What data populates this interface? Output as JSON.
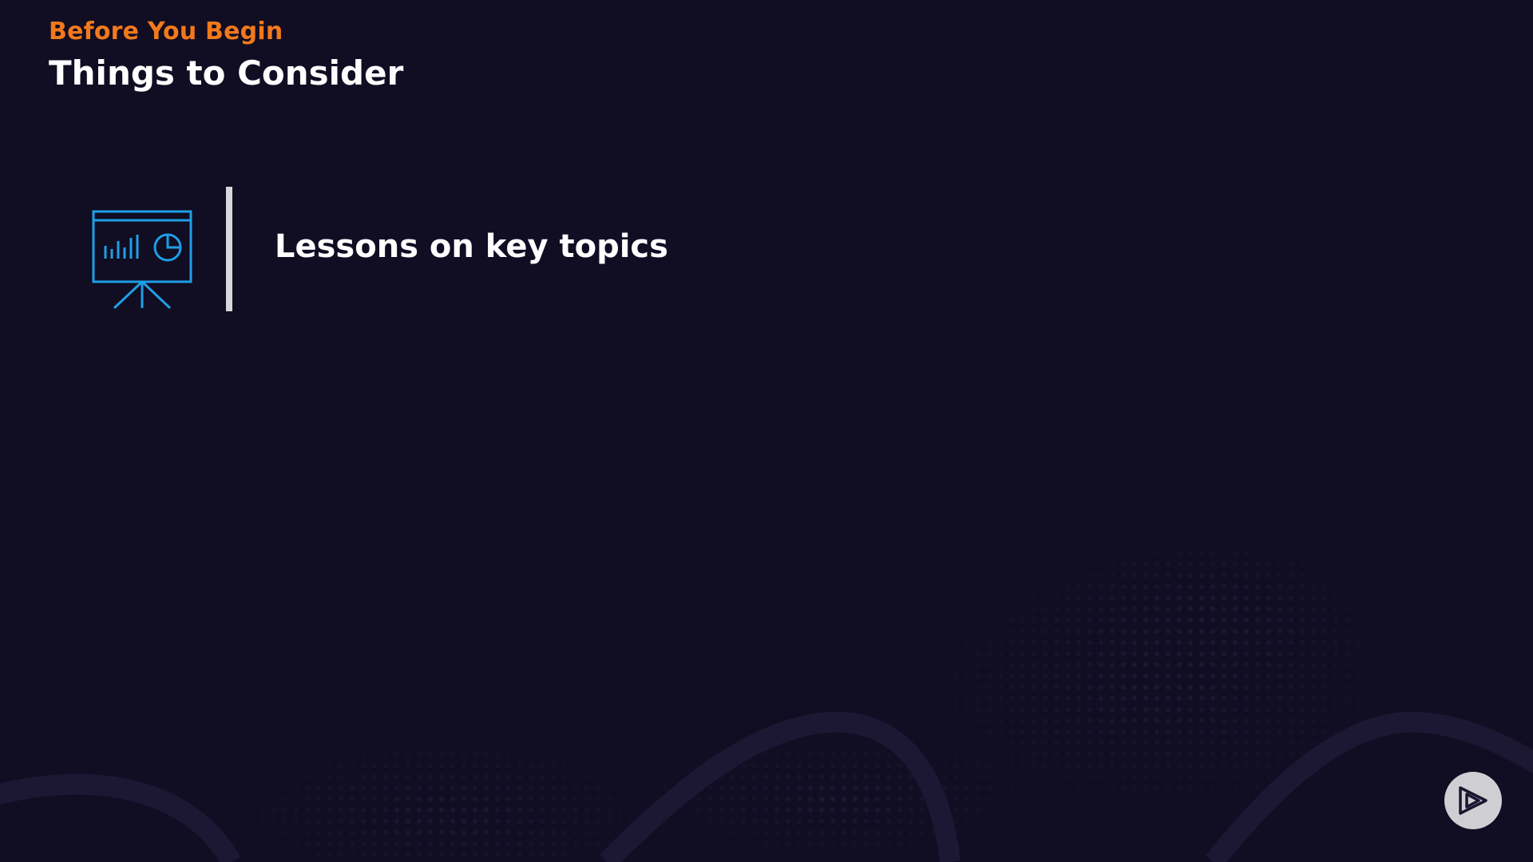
{
  "header": {
    "eyebrow": "Before You Begin",
    "title": "Things to Consider"
  },
  "items": [
    {
      "icon": "presentation-board-icon",
      "label": "Lessons on key topics"
    }
  ],
  "brand": {
    "icon": "pluralsight-play-logo-icon"
  },
  "colors": {
    "background": "#110d23",
    "accent": "#f2791b",
    "icon_blue": "#1e9fe6",
    "text": "#ffffff",
    "divider": "#d8d8dc",
    "logo_circle": "#cfcfd3"
  }
}
